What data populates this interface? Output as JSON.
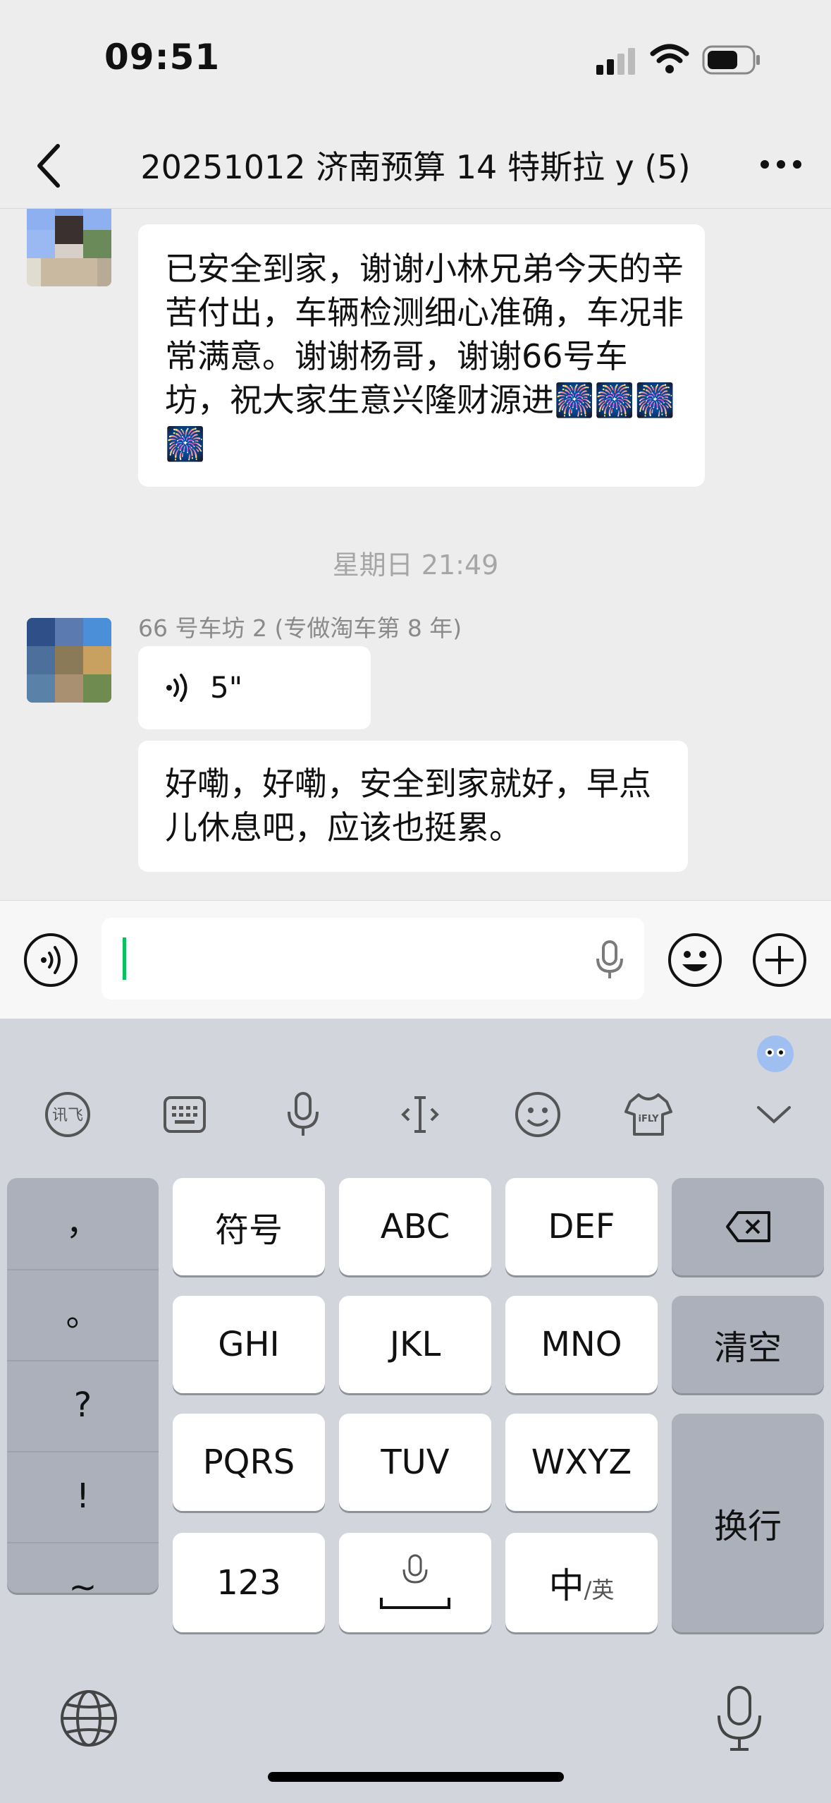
{
  "status_bar": {
    "time": "09:51"
  },
  "nav": {
    "title": "20251012 济南预算 14 特斯拉 y (5)"
  },
  "messages": {
    "msg1": {
      "text": "已安全到家，谢谢小林兄弟今天的辛苦付出，车辆检测细心准确，车况非常满意。谢谢杨哥，谢谢66号车坊，祝大家生意兴隆财源进🎆🎆🎆🎆"
    },
    "timestamp": "星期日 21:49",
    "sender": "66 号车坊 2 (专做淘车第 8 年)",
    "voice": {
      "duration": "5\""
    },
    "msg3": {
      "text": "好嘞，好嘞，安全到家就好，早点儿休息吧，应该也挺累。"
    }
  },
  "keyboard": {
    "punctuation": [
      "，",
      "。",
      "?",
      "!",
      "~"
    ],
    "keys": {
      "symbols": "符号",
      "abc": "ABC",
      "def": "DEF",
      "ghi": "GHI",
      "jkl": "JKL",
      "mno": "MNO",
      "clear": "清空",
      "pqrs": "PQRS",
      "tuv": "TUV",
      "wxyz": "WXYZ",
      "newline": "换行",
      "num": "123",
      "lang_main": "中",
      "lang_sub": "/英"
    },
    "toolbar_icons": [
      "xunfei-icon",
      "keyboard-icon",
      "mic-icon",
      "cursor-icon",
      "emoji-icon",
      "skin-icon",
      "collapse-icon"
    ]
  }
}
